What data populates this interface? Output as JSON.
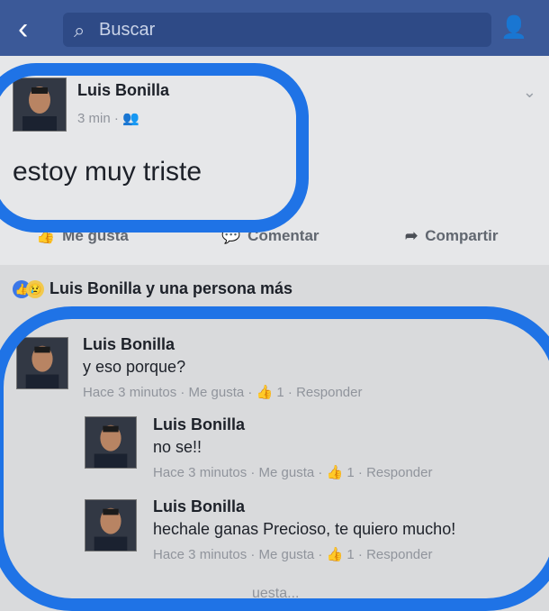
{
  "header": {
    "back_icon": "chevron-left-icon",
    "search_placeholder": "Buscar",
    "friends_icon": "friends-icon"
  },
  "post": {
    "author": "Luis Bonilla",
    "time": "3 min",
    "privacy_icon": "friends-icon",
    "status": "estoy muy triste",
    "actions": {
      "like": "Me gusta",
      "comment": "Comentar",
      "share": "Compartir"
    }
  },
  "reactions": {
    "text": "Luis Bonilla y una persona más"
  },
  "comments": [
    {
      "author": "Luis Bonilla",
      "text": "y eso porque?",
      "meta": "Hace 3 minutos · Me gusta · 👍 1 · Responder"
    },
    {
      "author": "Luis Bonilla",
      "text": "no se!!",
      "meta": "Hace 3 minutos · Me gusta · 👍 1 · Responder"
    },
    {
      "author": "Luis Bonilla",
      "text": "hechale ganas Precioso, te quiero mucho!",
      "meta": "Hace 3 minutos · Me gusta · 👍 1 · Responder"
    }
  ],
  "footer": {
    "partial": "uesta..."
  },
  "colors": {
    "header": "#3b5998",
    "highlight": "#1f73e6",
    "background": "#d9dadc"
  }
}
